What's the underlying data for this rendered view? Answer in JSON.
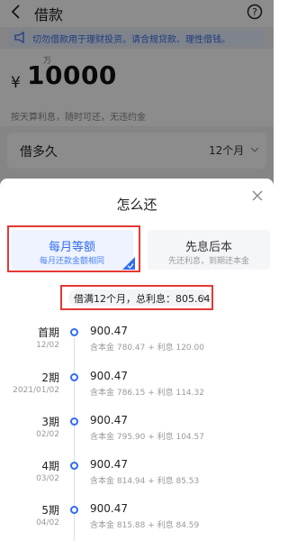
{
  "header": {
    "title": "借款"
  },
  "notice": {
    "text": "切勿借款用于理财投资。请合规贷款、理性借钱。"
  },
  "amount": {
    "unit": "万",
    "currency": "¥",
    "value": "10000",
    "subtitle": "按天算利息，随时可还，无违约金"
  },
  "term": {
    "label": "借多久",
    "value": "12个月"
  },
  "sheet": {
    "title": "怎么还",
    "options": [
      {
        "title": "每月等额",
        "subtitle": "每月还款金额相同",
        "selected": true
      },
      {
        "title": "先息后本",
        "subtitle": "先还利息，到期还本金",
        "selected": false
      }
    ],
    "summary": "借满12个月，总利息：805.64",
    "schedule": [
      {
        "period": "首期",
        "date": "12/02",
        "amount": "900.47",
        "detail": "含本金 780.47 + 利息 120.00"
      },
      {
        "period": "2期",
        "date": "2021/01/02",
        "amount": "900.47",
        "detail": "含本金 786.15 + 利息 114.32"
      },
      {
        "period": "3期",
        "date": "02/02",
        "amount": "900.47",
        "detail": "含本金 795.90 + 利息 104.57"
      },
      {
        "period": "4期",
        "date": "03/02",
        "amount": "900.47",
        "detail": "含本金 814.94 + 利息 85.53"
      },
      {
        "period": "5期",
        "date": "04/02",
        "amount": "900.47",
        "detail": "含本金 815.88 + 利息 84.59"
      }
    ]
  },
  "colors": {
    "accent": "#2f6cf0",
    "highlight": "#e53935",
    "overlay": "rgba(0,0,0,0.45)"
  }
}
